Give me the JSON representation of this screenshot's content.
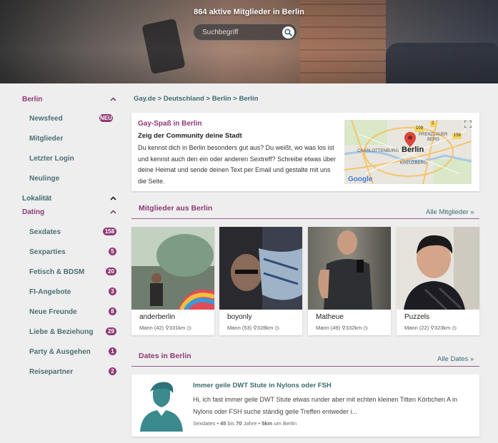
{
  "hero": {
    "title": "864 aktive Mitglieder in Berlin"
  },
  "search": {
    "placeholder": "Suchbegriff"
  },
  "sidebar": {
    "berlin": {
      "label": "Berlin",
      "items": [
        {
          "label": "Newsfeed",
          "badge": "NEU"
        },
        {
          "label": "Mitglieder"
        },
        {
          "label": "Letzter Login"
        },
        {
          "label": "Neulinge"
        }
      ]
    },
    "lokalitaet": {
      "label": "Lokalität"
    },
    "dating": {
      "label": "Dating",
      "items": [
        {
          "label": "Sexdates",
          "badge": "158"
        },
        {
          "label": "Sexparties",
          "badge": "5"
        },
        {
          "label": "Fetisch & BDSM",
          "badge": "20"
        },
        {
          "label": "FI-Angebote",
          "badge": "3"
        },
        {
          "label": "Neue Freunde",
          "badge": "8"
        },
        {
          "label": "Liebe & Beziehung",
          "badge": "29"
        },
        {
          "label": "Party & Ausgehen",
          "badge": "1"
        },
        {
          "label": "Reisepartner",
          "badge": "2"
        }
      ]
    }
  },
  "breadcrumb": {
    "items": [
      "Gay.de",
      "Deutschland",
      "Berlin",
      "Berlin"
    ],
    "separator": ">"
  },
  "intro": {
    "title": "Gay-Spaß in Berlin",
    "subtitle": "Zeig der Community deine Stadt",
    "text": "Du kennst dich in Berlin besonders gut aus? Du weißt, wo was los ist und kennst auch den ein oder anderen Sextreff? Schreibe etwas über deine Heimat und sende deinen Text per Email und gestalte mit uns die Seite.",
    "map": {
      "city": "Berlin",
      "labels": [
        "PRENZLAUER",
        "BERG",
        "CHARLOTTENBURG",
        "KREUZBERG",
        "109",
        "2",
        "158",
        "Google"
      ]
    }
  },
  "members_section": {
    "title": "Mitglieder aus Berlin",
    "link": "Alle Mitglieder »",
    "members": [
      {
        "name": "anderberlin",
        "meta1": "Mann (42)",
        "meta2": "331km"
      },
      {
        "name": "boyonly",
        "meta1": "Mann (53)",
        "meta2": "328km"
      },
      {
        "name": "Matheue",
        "meta1": "Mann (49)",
        "meta2": "332km"
      },
      {
        "name": "Puzzels",
        "meta1": "Mann (22)",
        "meta2": "323km"
      }
    ]
  },
  "dates_section": {
    "title": "Dates in Berlin",
    "link": "Alle Dates »",
    "item": {
      "title": "Immer geile DWT Stute in Nylons oder FSH",
      "text": "Hi, ich fast immer geile DWT Stute etwas runder aber mit echten kleinen Titten Körbchen A in Nylons oder FSH suche ständig geile Treffen entweder i...",
      "category": "Sexdates",
      "age_from": "45",
      "age_to": "70",
      "age_between": "bis",
      "age_unit": "Jahre",
      "distance": "5km",
      "distance_suffix": "um Berlin"
    }
  },
  "colors": {
    "accent": "#8e3a76",
    "teal": "#3d6b73",
    "background": "#eeeeee"
  }
}
